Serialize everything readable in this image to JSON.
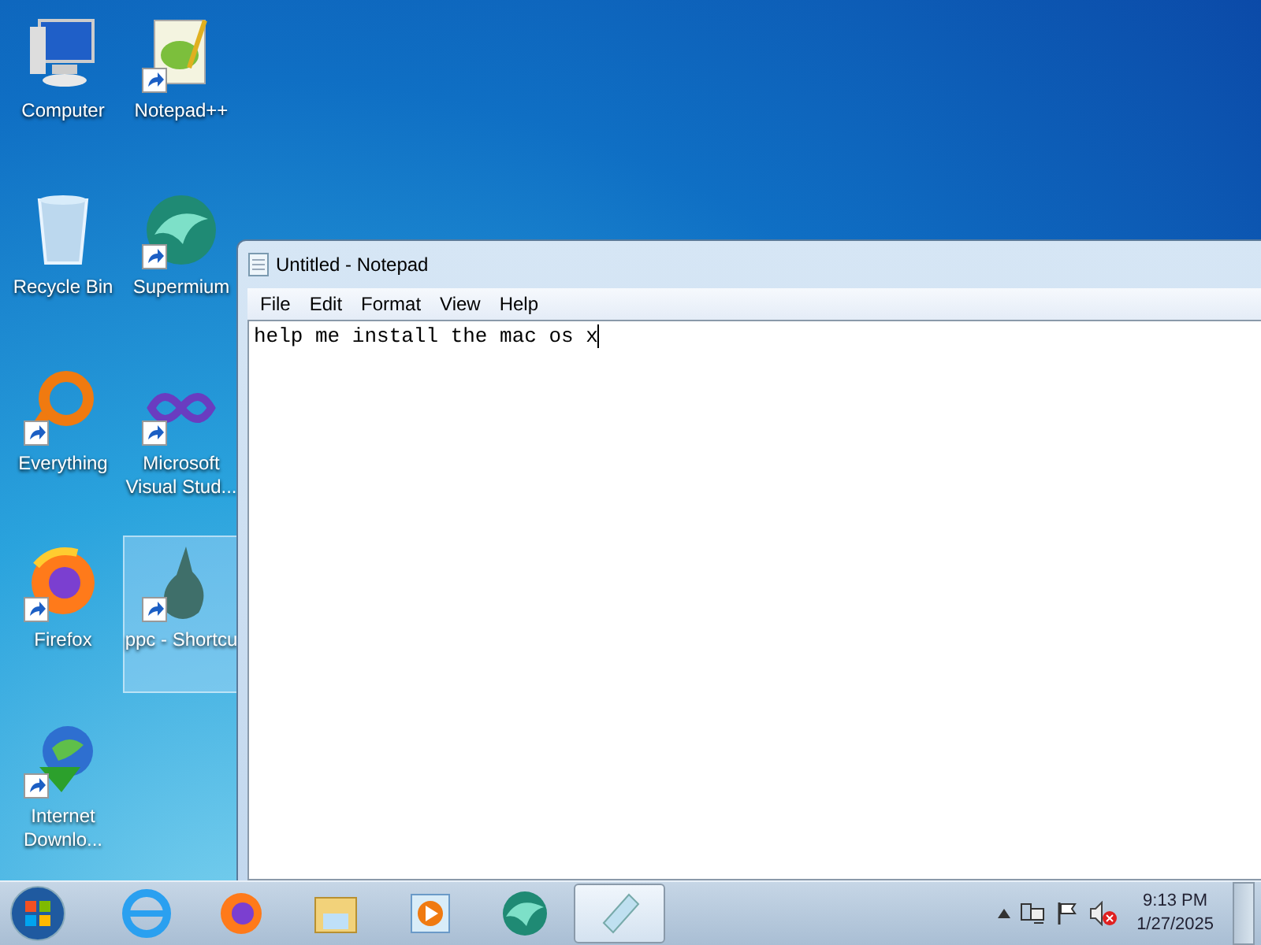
{
  "desktop_icons": [
    {
      "label": "Computer",
      "shortcut": false,
      "selected": false
    },
    {
      "label": "Notepad++",
      "shortcut": true,
      "selected": false
    },
    {
      "label": "Recycle Bin",
      "shortcut": false,
      "selected": false
    },
    {
      "label": "Supermium",
      "shortcut": true,
      "selected": false
    },
    {
      "label": "Everything",
      "shortcut": true,
      "selected": false
    },
    {
      "label": "Microsoft Visual Stud...",
      "shortcut": true,
      "selected": false
    },
    {
      "label": "Firefox",
      "shortcut": true,
      "selected": false
    },
    {
      "label": "ppc - Shortcu",
      "shortcut": true,
      "selected": true
    },
    {
      "label": "Internet Downlo...",
      "shortcut": true,
      "selected": false
    }
  ],
  "window": {
    "title": "Untitled - Notepad",
    "menu": [
      "File",
      "Edit",
      "Format",
      "View",
      "Help"
    ],
    "text": "help me install the mac os x"
  },
  "taskbar": {
    "items": [
      {
        "selected": false
      },
      {
        "selected": false
      },
      {
        "selected": false
      },
      {
        "selected": false
      },
      {
        "selected": false
      },
      {
        "selected": true
      }
    ],
    "tray": {
      "volume_muted": true,
      "time": "9:13 PM",
      "date": "1/27/2025"
    }
  }
}
